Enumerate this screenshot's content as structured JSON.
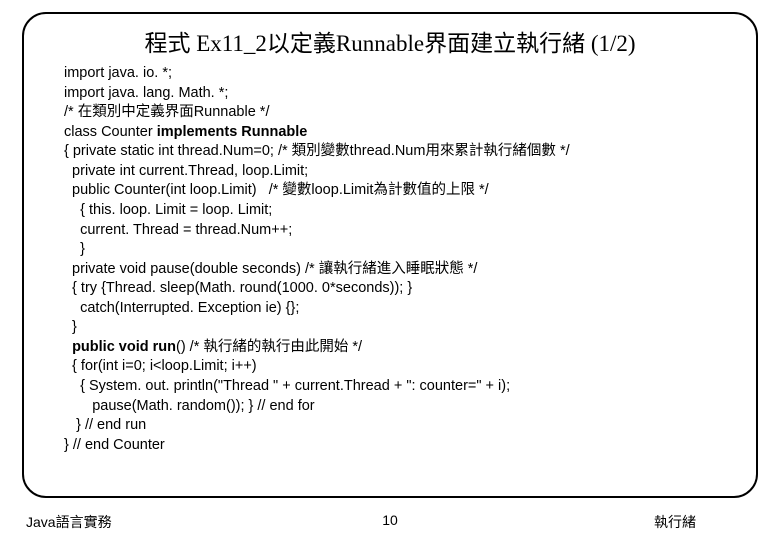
{
  "title": {
    "text_main": "程式 Ex11_2以定義Runnable界面建立執行緒 ",
    "pager": "(1/2)"
  },
  "code": {
    "l1": "import java. io. *;",
    "l2": "import java. lang. Math. *;",
    "l3": "/* 在類別中定義界面Runnable */",
    "l4a": "class Counter ",
    "l4b": "implements Runnable",
    "l5": "{ private static int thread.Num=0; /* 類別變數thread.Num用來累計執行緒個數 */",
    "l6": "  private int current.Thread, loop.Limit;",
    "l7": "",
    "l8": "  public Counter(int loop.Limit)   /* 變數loop.Limit為計數值的上限 */",
    "l9": "    { this. loop. Limit = loop. Limit;",
    "l10": "    current. Thread = thread.Num++;",
    "l11": "    }",
    "l12": "  private void pause(double seconds) /* 讓執行緒進入睡眠狀態 */",
    "l13": "  { try {Thread. sleep(Math. round(1000. 0*seconds)); }",
    "l14": "    catch(Interrupted. Exception ie) {};",
    "l15": "  }",
    "l16a": "  ",
    "l16b": "public void run",
    "l16c": "() /* 執行緒的執行由此開始 */",
    "l17": "  { for(int i=0; i<loop.Limit; i++)",
    "l18": "    { System. out. println(\"Thread \" + current.Thread + \": counter=\" + i);",
    "l19": "       pause(Math. random()); } // end for",
    "l20": "   } // end run",
    "l21": "} // end Counter"
  },
  "footer": {
    "left": "Java語言實務",
    "center": "10",
    "right": "執行緒"
  }
}
